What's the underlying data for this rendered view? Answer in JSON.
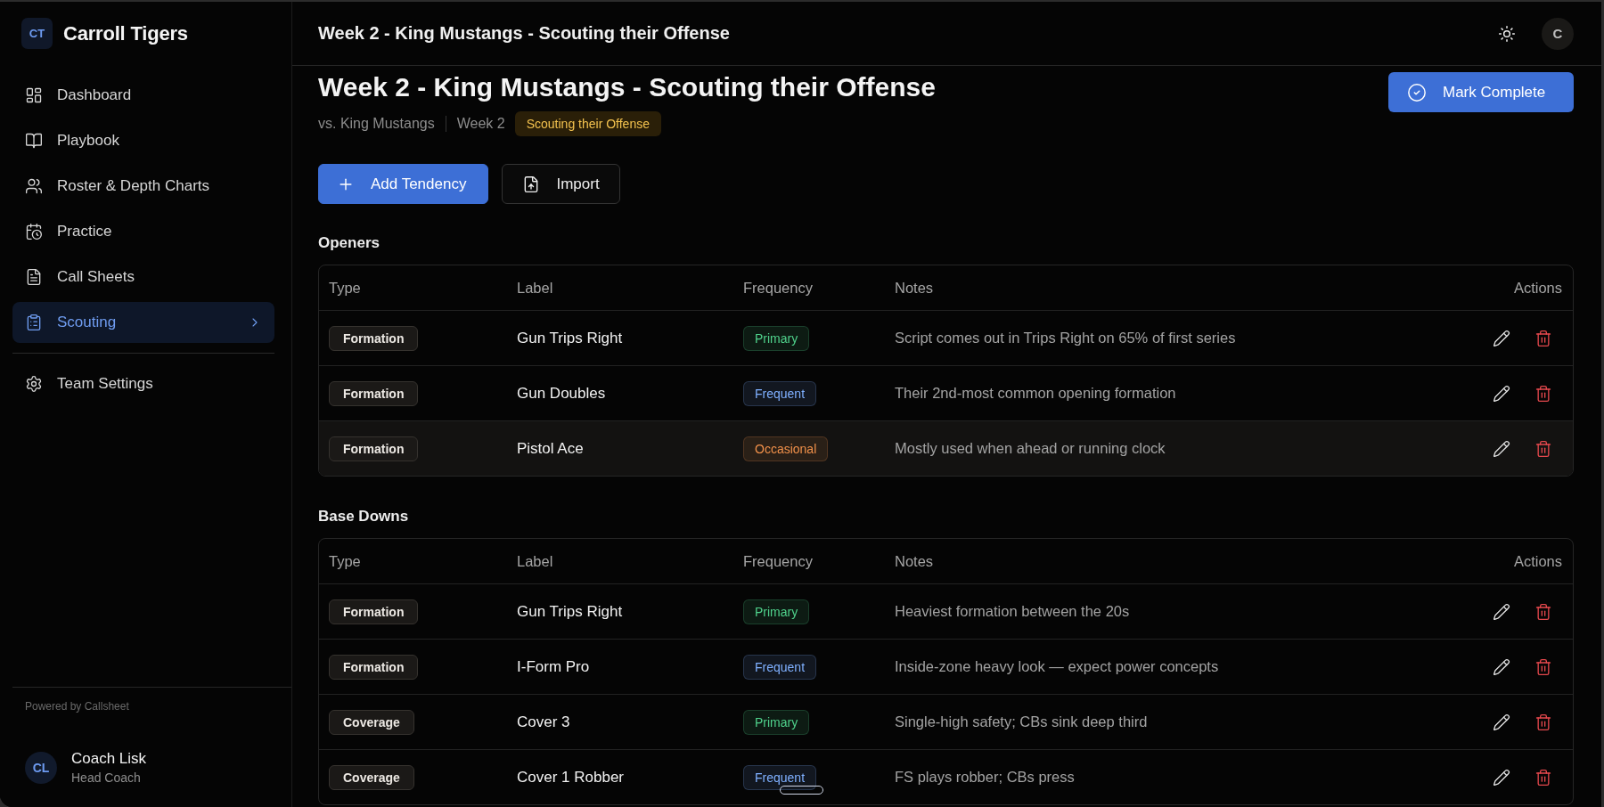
{
  "sidebar": {
    "brand": {
      "initials": "CT",
      "name": "Carroll Tigers"
    },
    "nav": [
      {
        "label": "Dashboard",
        "selected": false
      },
      {
        "label": "Playbook",
        "selected": false
      },
      {
        "label": "Roster & Depth Charts",
        "selected": false
      },
      {
        "label": "Practice",
        "selected": false
      },
      {
        "label": "Call Sheets",
        "selected": false
      },
      {
        "label": "Scouting",
        "selected": true
      }
    ],
    "settings": [
      {
        "label": "Team Settings",
        "selected": false
      }
    ],
    "footer": "Powered by Callsheet",
    "user": {
      "initials": "CL",
      "name": "Coach Lisk",
      "role": "Head Coach"
    }
  },
  "topbar": {
    "title": "Week 2 - King Mustangs - Scouting their Offense",
    "avatar": "C"
  },
  "page": {
    "title": "Week 2 - King Mustangs - Scouting their Offense",
    "complete_button": "Mark Complete",
    "meta": {
      "opponent": "vs. King Mustangs",
      "week": "Week 2",
      "status": "Scouting their Offense"
    },
    "actions": [
      {
        "label": "Add Tendency",
        "kind": "primary"
      },
      {
        "label": "Import",
        "kind": "secondary"
      }
    ]
  },
  "sections": [
    {
      "title": "Openers",
      "columns": [
        "Type",
        "Label",
        "Frequency",
        "Notes",
        "Actions"
      ],
      "rows": [
        {
          "type": "Formation",
          "label": "Gun Trips Right",
          "frequency": {
            "text": "Primary",
            "color": "#4fd18b"
          },
          "notes": "Script comes out in Trips Right on 65% of first series",
          "highlighted": false
        },
        {
          "type": "Formation",
          "label": "Gun Doubles",
          "frequency": {
            "text": "Frequent",
            "color": "#7fb0ff"
          },
          "notes": "Their 2nd-most common opening formation",
          "highlighted": false
        },
        {
          "type": "Formation",
          "label": "Pistol Ace",
          "frequency": {
            "text": "Occasional",
            "color": "#f0904a"
          },
          "notes": "Mostly used when ahead or running clock",
          "highlighted": true
        }
      ]
    },
    {
      "title": "Base Downs",
      "columns": [
        "Type",
        "Label",
        "Frequency",
        "Notes",
        "Actions"
      ],
      "rows": [
        {
          "type": "Formation",
          "label": "Gun Trips Right",
          "frequency": {
            "text": "Primary",
            "color": "#4fd18b"
          },
          "notes": "Heaviest formation between the 20s",
          "highlighted": false
        },
        {
          "type": "Formation",
          "label": "I-Form Pro",
          "frequency": {
            "text": "Frequent",
            "color": "#7fb0ff"
          },
          "notes": "Inside-zone heavy look — expect power concepts",
          "highlighted": false
        },
        {
          "type": "Coverage",
          "label": "Cover 3",
          "frequency": {
            "text": "Primary",
            "color": "#4fd18b"
          },
          "notes": "Single-high safety; CBs sink deep third",
          "highlighted": false
        },
        {
          "type": "Coverage",
          "label": "Cover 1 Robber",
          "frequency": {
            "text": "Frequent",
            "color": "#7fb0ff"
          },
          "notes": "FS plays robber; CBs press",
          "highlighted": false
        }
      ]
    }
  ]
}
